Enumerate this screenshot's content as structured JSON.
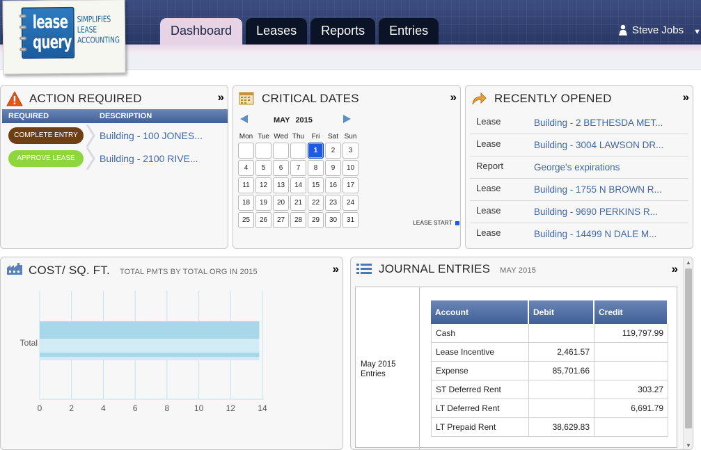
{
  "brand": {
    "logo_line1": "lease",
    "logo_line2": "query",
    "tagline_1": "Simplifies",
    "tagline_2": "Lease",
    "tagline_3": "Accounting"
  },
  "nav": {
    "tabs": [
      {
        "label": "Dashboard",
        "active": true
      },
      {
        "label": "Leases",
        "active": false
      },
      {
        "label": "Reports",
        "active": false
      },
      {
        "label": "Entries",
        "active": false
      }
    ],
    "user_name": "Steve Jobs"
  },
  "action_required": {
    "title": "ACTION REQUIRED",
    "more": "»",
    "col_required": "REQUIRED",
    "col_description": "DESCRIPTION",
    "rows": [
      {
        "action": "COMPLETE ENTRY",
        "color": "#6e3f12",
        "description": "Building - 100 JONES..."
      },
      {
        "action": "APPROVE LEASE",
        "color": "#8fd63c",
        "description": "Building - 2100 RIVE..."
      }
    ]
  },
  "critical_dates": {
    "title": "CRITICAL DATES",
    "more": "»",
    "month": "MAY",
    "year": "2015",
    "weekdays": [
      "Mon",
      "Tue",
      "Wed",
      "Thu",
      "Fri",
      "Sat",
      "Sun"
    ],
    "leading_blanks": 4,
    "days_in_month": 31,
    "highlighted_day": 1,
    "legend": "LEASE START",
    "legend_color": "#1e5be0"
  },
  "recently_opened": {
    "title": "RECENTLY OPENED",
    "more": "»",
    "items": [
      {
        "type": "Lease",
        "name": "Building - 2 BETHESDA MET..."
      },
      {
        "type": "Lease",
        "name": "Building - 3004 LAWSON DR..."
      },
      {
        "type": "Report",
        "name": "George's expirations"
      },
      {
        "type": "Lease",
        "name": "Building - 1755 N BROWN R..."
      },
      {
        "type": "Lease",
        "name": "Building - 9690 PERKINS R..."
      },
      {
        "type": "Lease",
        "name": "Building - 14499 N DALE M..."
      }
    ]
  },
  "cost_sqft": {
    "title": "COST/ SQ. FT.",
    "subtitle": "TOTAL PMTS BY TOTAL ORG IN 2015",
    "more": "»"
  },
  "chart_data": {
    "type": "bar",
    "orientation": "horizontal",
    "categories": [
      "Total"
    ],
    "values": [
      13.8
    ],
    "xlim": [
      0,
      14
    ],
    "x_ticks": [
      "0",
      "2",
      "4",
      "6",
      "8",
      "10",
      "12",
      "14"
    ],
    "grid": true,
    "bar_color": "#a9d7ea"
  },
  "journal_entries": {
    "title": "JOURNAL ENTRIES",
    "subtitle": "MAY 2015",
    "more": "»",
    "period_label": "May 2015 Entries",
    "columns": [
      "Account",
      "Debit",
      "Credit"
    ],
    "rows": [
      {
        "account": "Cash",
        "debit": "",
        "credit": "119,797.99"
      },
      {
        "account": "Lease Incentive",
        "debit": "2,461.57",
        "credit": ""
      },
      {
        "account": "Expense",
        "debit": "85,701.66",
        "credit": ""
      },
      {
        "account": "ST Deferred Rent",
        "debit": "",
        "credit": "303.27"
      },
      {
        "account": "LT Deferred Rent",
        "debit": "",
        "credit": "6,691.79"
      },
      {
        "account": "LT Prepaid Rent",
        "debit": "38,629.83",
        "credit": ""
      }
    ]
  }
}
